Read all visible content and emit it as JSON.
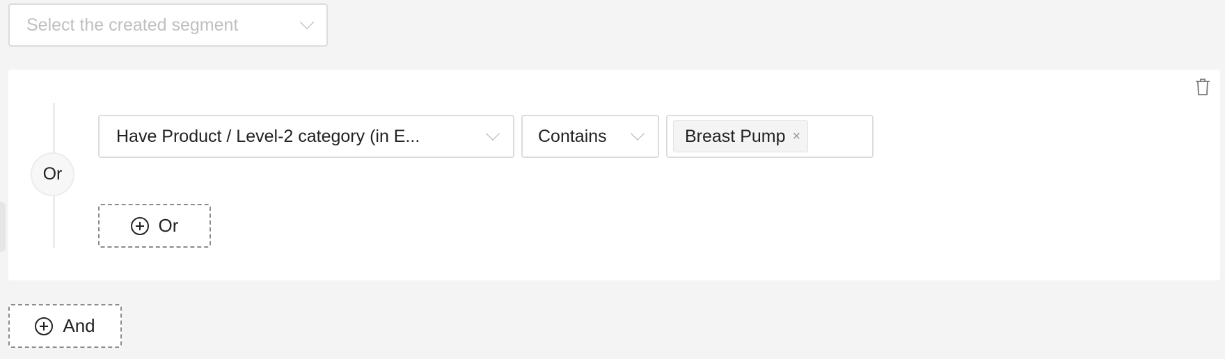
{
  "segment_select": {
    "placeholder": "Select the created segment"
  },
  "condition_group": {
    "connector": "Or",
    "conditions": [
      {
        "field": "Have Product / Level-2 category (in E...",
        "operator": "Contains",
        "values": [
          "Breast Pump"
        ]
      }
    ],
    "add_or_label": "Or"
  },
  "add_and_label": "And"
}
